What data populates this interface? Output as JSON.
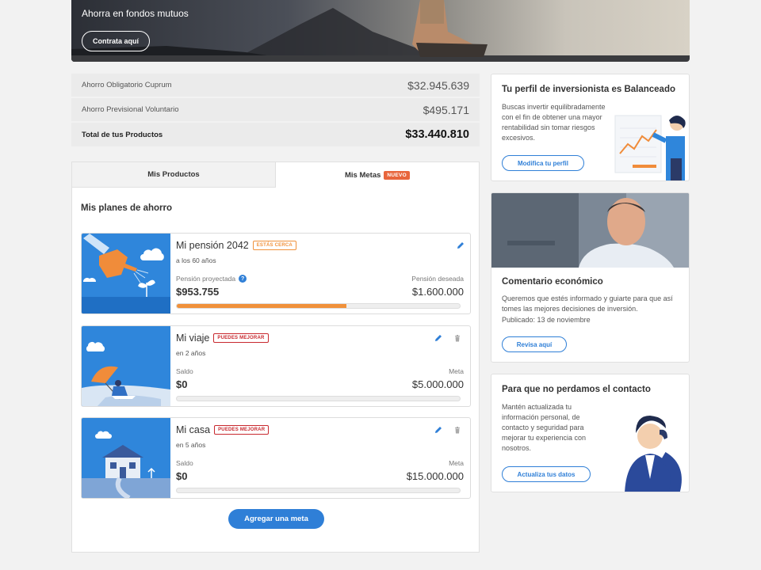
{
  "hero": {
    "title": "Ahorra en fondos mutuos",
    "button": "Contrata aquí"
  },
  "summary": {
    "rows": [
      {
        "label": "Ahorro Obligatorio Cuprum",
        "value": "$32.945.639"
      },
      {
        "label": "Ahorro Previsional Voluntario",
        "value": "$495.171"
      }
    ],
    "total": {
      "label": "Total de tus Productos",
      "value": "$33.440.810"
    }
  },
  "tabs": {
    "products": "Mis Productos",
    "goals": "Mis Metas",
    "goals_badge": "NUEVO"
  },
  "plans": {
    "title": "Mis planes de ahorro",
    "items": [
      {
        "name": "Mi pensión 2042",
        "tag": "ESTÁS CERCA",
        "sub": "a los 60 años",
        "left_label": "Pensión proyectada",
        "left_value": "$953.755",
        "right_label": "Pensión deseada",
        "right_value": "$1.600.000",
        "progress": 0.6
      },
      {
        "name": "Mi viaje",
        "tag": "PUEDES MEJORAR",
        "sub": "en 2 años",
        "left_label": "Saldo",
        "left_value": "$0",
        "right_label": "Meta",
        "right_value": "$5.000.000",
        "progress": 0
      },
      {
        "name": "Mi casa",
        "tag": "PUEDES MEJORAR",
        "sub": "en 5 años",
        "left_label": "Saldo",
        "left_value": "$0",
        "right_label": "Meta",
        "right_value": "$15.000.000",
        "progress": 0
      }
    ],
    "add_button": "Agregar una meta"
  },
  "profile": {
    "title": "Tu perfil de inversionista es Balanceado",
    "text": "Buscas invertir equilibradamente con el fin de obtener una mayor rentabilidad sin tomar riesgos excesivos.",
    "button": "Modifica tu perfil"
  },
  "commentary": {
    "title": "Comentario económico",
    "text": "Queremos que estés informado y guiarte para que así tomes las mejores decisiones de inversión.",
    "published": "Publicado: 13 de noviembre",
    "button": "Revisa aquí"
  },
  "contact": {
    "title": "Para que no perdamos el contacto",
    "text": "Mantén actualizada tu información personal, de contacto y seguridad para mejorar tu experiencia con nosotros.",
    "button": "Actualiza tus datos"
  },
  "colors": {
    "primary": "#2f7fd7",
    "orange": "#f0913b",
    "red": "#c8282e",
    "badge": "#e8663c"
  },
  "icons": [
    "pencil-icon",
    "trash-icon",
    "help-icon"
  ]
}
